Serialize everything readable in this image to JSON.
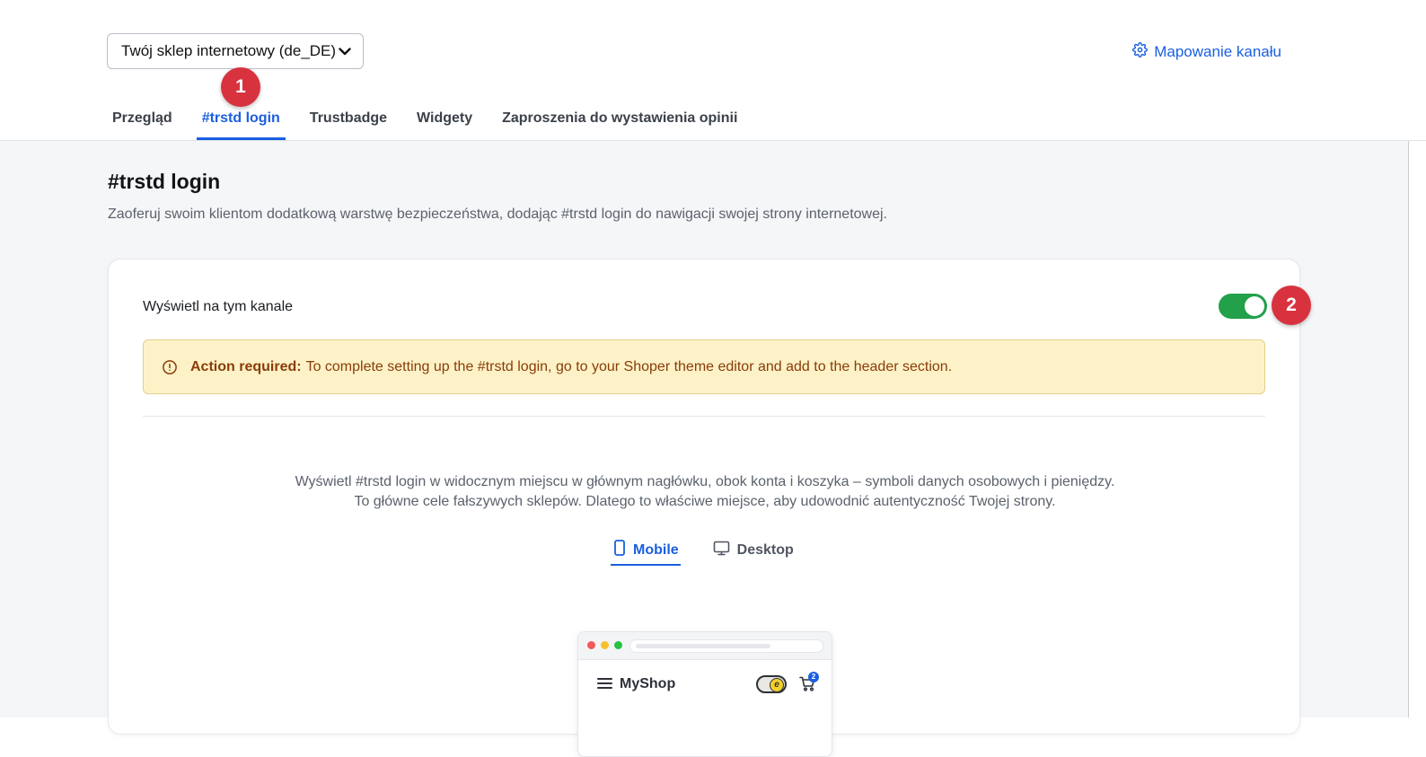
{
  "header": {
    "channel_selector": {
      "value": "Twój sklep internetowy (de_DE)",
      "icon": "chevron-down-icon"
    },
    "channel_mapping_link": {
      "label": "Mapowanie kanału",
      "icon": "gear-icon"
    },
    "tabs": [
      {
        "label": "Przegląd",
        "active": false
      },
      {
        "label": "#trstd login",
        "active": true
      },
      {
        "label": "Trustbadge",
        "active": false
      },
      {
        "label": "Widgety",
        "active": false
      },
      {
        "label": "Zaproszenia do wystawienia opinii",
        "active": false
      }
    ]
  },
  "annotations": {
    "marker_1": "1",
    "marker_2": "2"
  },
  "page": {
    "title": "#trstd login",
    "description": "Zaoferuj swoim klientom dodatkową warstwę bezpieczeństwa, dodając #trstd login do nawigacji swojej strony internetowej."
  },
  "card": {
    "display_label": "Wyświetl na tym kanale",
    "display_toggle_on": true,
    "alert": {
      "icon": "alert-circle-icon",
      "title": "Action required:",
      "message": "To complete setting up the #trstd login, go to your Shoper theme editor and add to the header section."
    },
    "help_text": "Wyświetl #trstd login w widocznym miejscu w głównym nagłówku, obok konta i koszyka – symboli danych osobowych i pieniędzy. To główne cele fałszywych sklepów. Dlatego to właściwe miejsce, aby udowodnić autentyczność Twojej strony.",
    "device_tabs": [
      {
        "label": "Mobile",
        "icon": "smartphone-icon",
        "active": true
      },
      {
        "label": "Desktop",
        "icon": "monitor-icon",
        "active": false
      }
    ],
    "preview": {
      "shop_name": "MyShop",
      "toggle_coin": "e",
      "cart_count": "2"
    }
  },
  "colors": {
    "accent": "#1a5fe0",
    "toggle_on": "#22a04a",
    "alert_bg": "#fdf2c7",
    "alert_text": "#8a3c09",
    "marker": "#d9323f"
  }
}
